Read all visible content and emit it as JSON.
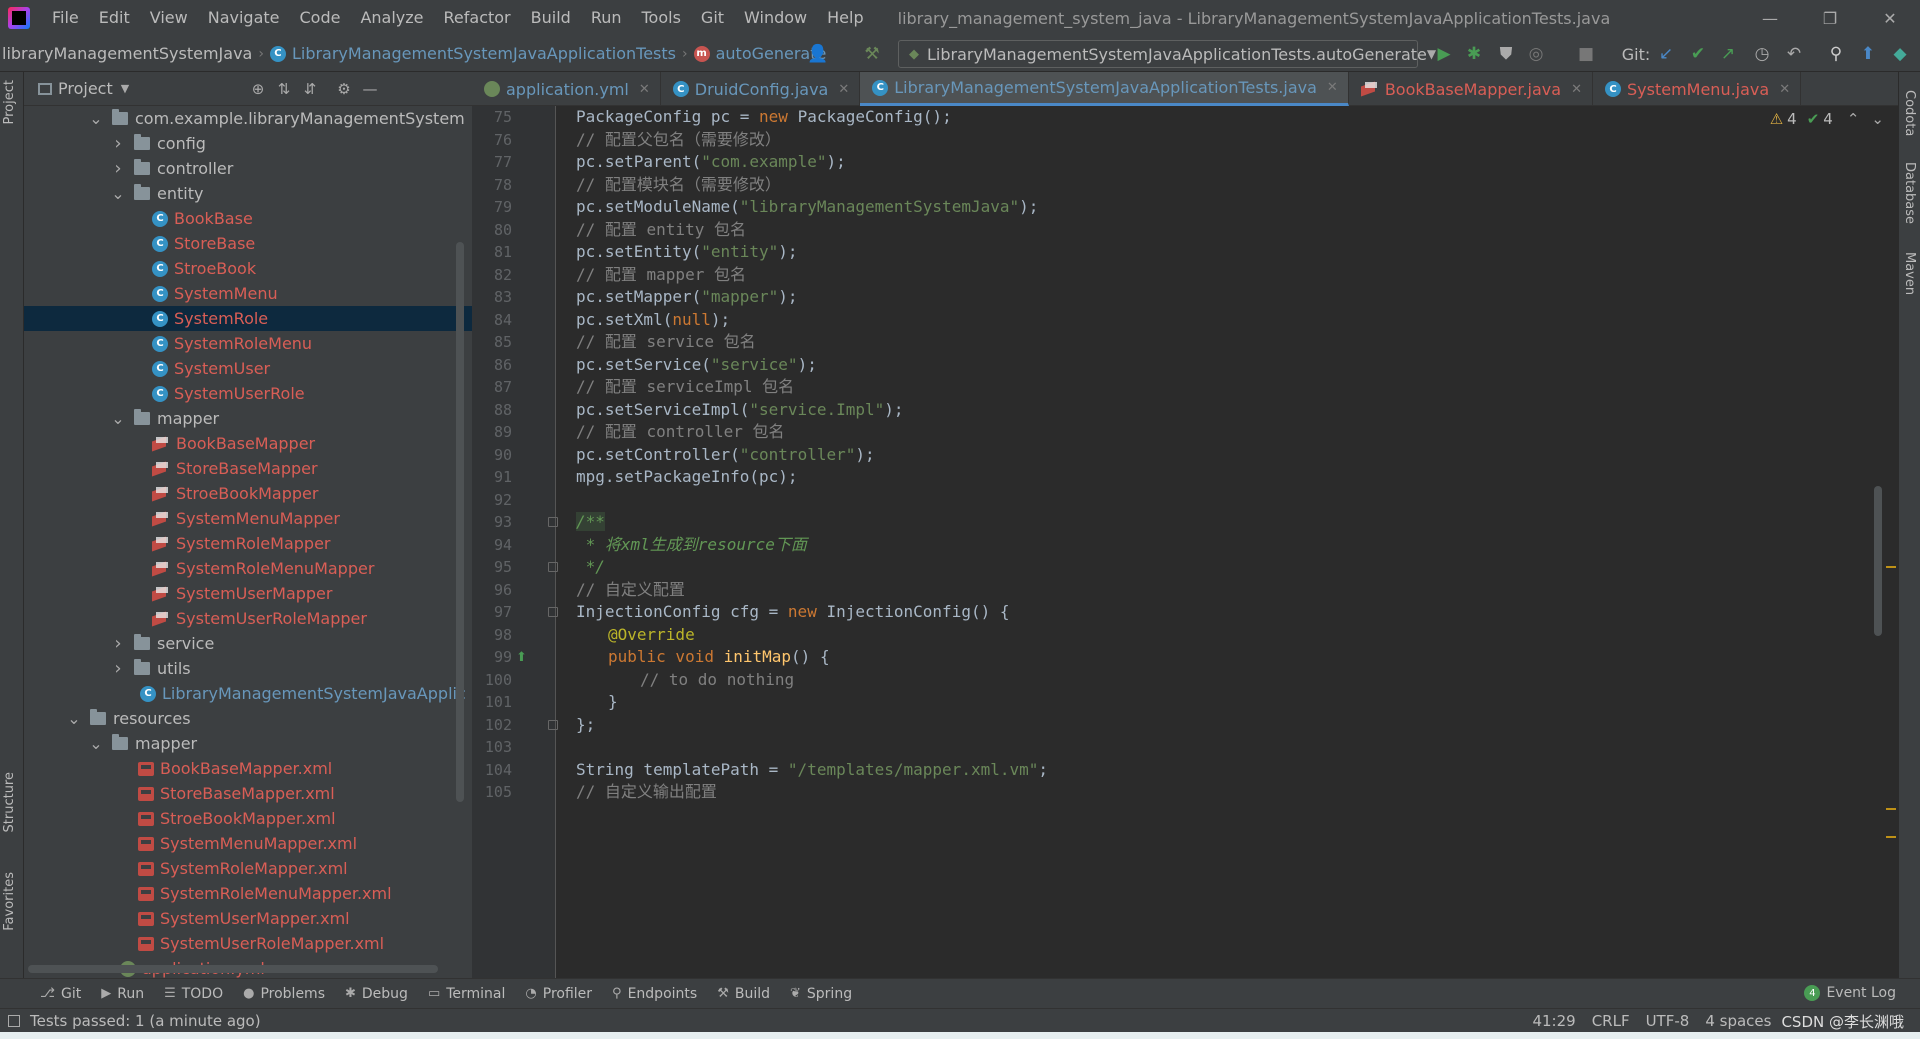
{
  "window": {
    "title": "library_management_system_java - LibraryManagementSystemJavaApplicationTests.java",
    "menu": [
      "File",
      "Edit",
      "View",
      "Navigate",
      "Code",
      "Analyze",
      "Refactor",
      "Build",
      "Run",
      "Tools",
      "Git",
      "Window",
      "Help"
    ]
  },
  "navbar": {
    "crumbs": [
      "libraryManagementSystemJava",
      "LibraryManagementSystemJavaApplicationTests",
      "autoGenerate"
    ],
    "run_config": "LibraryManagementSystemJavaApplicationTests.autoGenerate",
    "git_label": "Git:"
  },
  "project": {
    "title": "Project",
    "tree": [
      {
        "label": "com.example.libraryManagementSystem",
        "type": "package",
        "indent": 1,
        "arrow": "down"
      },
      {
        "label": "config",
        "type": "folder",
        "indent": 2,
        "arrow": "right"
      },
      {
        "label": "controller",
        "type": "folder",
        "indent": 2,
        "arrow": "right"
      },
      {
        "label": "entity",
        "type": "folder",
        "indent": 2,
        "arrow": "down"
      },
      {
        "label": "BookBase",
        "type": "class",
        "indent": 3
      },
      {
        "label": "StoreBase",
        "type": "class",
        "indent": 3
      },
      {
        "label": "StroeBook",
        "type": "class",
        "indent": 3
      },
      {
        "label": "SystemMenu",
        "type": "class",
        "indent": 3
      },
      {
        "label": "SystemRole",
        "type": "class",
        "indent": 3,
        "selected": true
      },
      {
        "label": "SystemRoleMenu",
        "type": "class",
        "indent": 3
      },
      {
        "label": "SystemUser",
        "type": "class",
        "indent": 3
      },
      {
        "label": "SystemUserRole",
        "type": "class",
        "indent": 3
      },
      {
        "label": "mapper",
        "type": "folder",
        "indent": 2,
        "arrow": "down"
      },
      {
        "label": "BookBaseMapper",
        "type": "mapper",
        "indent": 3
      },
      {
        "label": "StoreBaseMapper",
        "type": "mapper",
        "indent": 3
      },
      {
        "label": "StroeBookMapper",
        "type": "mapper",
        "indent": 3
      },
      {
        "label": "SystemMenuMapper",
        "type": "mapper",
        "indent": 3
      },
      {
        "label": "SystemRoleMapper",
        "type": "mapper",
        "indent": 3
      },
      {
        "label": "SystemRoleMenuMapper",
        "type": "mapper",
        "indent": 3
      },
      {
        "label": "SystemUserMapper",
        "type": "mapper",
        "indent": 3
      },
      {
        "label": "SystemUserRoleMapper",
        "type": "mapper",
        "indent": 3
      },
      {
        "label": "service",
        "type": "folder",
        "indent": 2,
        "arrow": "right"
      },
      {
        "label": "utils",
        "type": "folder",
        "indent": 2,
        "arrow": "right"
      },
      {
        "label": "LibraryManagementSystemJavaApplic",
        "type": "appclass",
        "indent": 2
      },
      {
        "label": "resources",
        "type": "resfolder",
        "indent": 0,
        "arrow": "down"
      },
      {
        "label": "mapper",
        "type": "folder",
        "indent": 1,
        "arrow": "down"
      },
      {
        "label": "BookBaseMapper.xml",
        "type": "xml",
        "indent": 2
      },
      {
        "label": "StoreBaseMapper.xml",
        "type": "xml",
        "indent": 2
      },
      {
        "label": "StroeBookMapper.xml",
        "type": "xml",
        "indent": 2
      },
      {
        "label": "SystemMenuMapper.xml",
        "type": "xml",
        "indent": 2
      },
      {
        "label": "SystemRoleMapper.xml",
        "type": "xml",
        "indent": 2
      },
      {
        "label": "SystemRoleMenuMapper.xml",
        "type": "xml",
        "indent": 2
      },
      {
        "label": "SystemUserMapper.xml",
        "type": "xml",
        "indent": 2
      },
      {
        "label": "SystemUserRoleMapper.xml",
        "type": "xml",
        "indent": 2
      },
      {
        "label": "application.yml",
        "type": "yml",
        "indent": 1
      }
    ]
  },
  "tabs": [
    {
      "label": "application.yml",
      "icon": "yml",
      "color": "blue"
    },
    {
      "label": "DruidConfig.java",
      "icon": "class",
      "color": "blue"
    },
    {
      "label": "LibraryManagementSystemJavaApplicationTests.java",
      "icon": "class",
      "color": "blue",
      "active": true
    },
    {
      "label": "BookBaseMapper.java",
      "icon": "mapper",
      "color": "red"
    },
    {
      "label": "SystemMenu.java",
      "icon": "class",
      "color": "red"
    }
  ],
  "editor": {
    "warnings": "4",
    "checks": "4",
    "lines": [
      {
        "n": "75",
        "html": "PackageConfig pc = <span class=\"kw\">new</span> PackageConfig();",
        "indent": 0
      },
      {
        "n": "76",
        "html": "<span class=\"cm\">// 配置父包名（需要修改）</span>",
        "indent": 0
      },
      {
        "n": "77",
        "html": "pc.setParent(<span class=\"str\">\"com.example\"</span>);",
        "indent": 0
      },
      {
        "n": "78",
        "html": "<span class=\"cm\">// 配置模块名（需要修改）</span>",
        "indent": 0
      },
      {
        "n": "79",
        "html": "pc.setModuleName(<span class=\"str\">\"libraryManagementSystemJava\"</span>);",
        "indent": 0
      },
      {
        "n": "80",
        "html": "<span class=\"cm\">// 配置 entity 包名</span>",
        "indent": 0
      },
      {
        "n": "81",
        "html": "pc.setEntity(<span class=\"str\">\"entity\"</span>);",
        "indent": 0
      },
      {
        "n": "82",
        "html": "<span class=\"cm\">// 配置 mapper 包名</span>",
        "indent": 0
      },
      {
        "n": "83",
        "html": "pc.setMapper(<span class=\"str\">\"mapper\"</span>);",
        "indent": 0
      },
      {
        "n": "84",
        "html": "pc.setXml(<span class=\"kw\">null</span>);",
        "indent": 0
      },
      {
        "n": "85",
        "html": "<span class=\"cm\">// 配置 service 包名</span>",
        "indent": 0
      },
      {
        "n": "86",
        "html": "pc.setService(<span class=\"str\">\"service\"</span>);",
        "indent": 0
      },
      {
        "n": "87",
        "html": "<span class=\"cm\">// 配置 serviceImpl 包名</span>",
        "indent": 0
      },
      {
        "n": "88",
        "html": "pc.setServiceImpl(<span class=\"str\">\"service.Impl\"</span>);",
        "indent": 0
      },
      {
        "n": "89",
        "html": "<span class=\"cm\">// 配置 controller 包名</span>",
        "indent": 0
      },
      {
        "n": "90",
        "html": "pc.setController(<span class=\"str\">\"controller\"</span>);",
        "indent": 0
      },
      {
        "n": "91",
        "html": "mpg.setPackageInfo(pc);",
        "indent": 0
      },
      {
        "n": "92",
        "html": "",
        "indent": 0
      },
      {
        "n": "93",
        "html": "<span class=\"doc doc-bg\">/**</span>",
        "indent": 0
      },
      {
        "n": "94",
        "html": "<span class=\"doc\"> * 将xml生成到resource下面</span>",
        "indent": 0
      },
      {
        "n": "95",
        "html": "<span class=\"doc\"> */</span>",
        "indent": 0
      },
      {
        "n": "96",
        "html": "<span class=\"cm\">// 自定义配置</span>",
        "indent": 0
      },
      {
        "n": "97",
        "html": "InjectionConfig cfg = <span class=\"kw\">new</span> InjectionConfig() {",
        "indent": 0
      },
      {
        "n": "98",
        "html": "<span class=\"ann\">@Override</span>",
        "indent": 1
      },
      {
        "n": "99",
        "html": "<span class=\"kw\">public void</span> <span class=\"fn\">initMap</span>() {",
        "indent": 1
      },
      {
        "n": "100",
        "html": "<span class=\"cm\">// to do nothing</span>",
        "indent": 2
      },
      {
        "n": "101",
        "html": "}",
        "indent": 1
      },
      {
        "n": "102",
        "html": "};",
        "indent": 0
      },
      {
        "n": "103",
        "html": "",
        "indent": 0
      },
      {
        "n": "104",
        "html": "String templatePath = <span class=\"str\">\"/templates/mapper.xml.vm\"</span>;",
        "indent": 0
      },
      {
        "n": "105",
        "html": "<span class=\"cm\">// 自定义输出配置</span>",
        "indent": 0
      }
    ]
  },
  "bottom_tabs": [
    {
      "label": "Git",
      "icon": "git-icon",
      "glyph": "⎇"
    },
    {
      "label": "Run",
      "icon": "run-icon",
      "glyph": "▶"
    },
    {
      "label": "TODO",
      "icon": "todo-icon",
      "glyph": "☰"
    },
    {
      "label": "Problems",
      "icon": "problems-icon",
      "glyph": "●"
    },
    {
      "label": "Debug",
      "icon": "debug-icon",
      "glyph": "✱"
    },
    {
      "label": "Terminal",
      "icon": "terminal-icon",
      "glyph": "▭"
    },
    {
      "label": "Profiler",
      "icon": "profiler-icon",
      "glyph": "◔"
    },
    {
      "label": "Endpoints",
      "icon": "endpoints-icon",
      "glyph": "⚲"
    },
    {
      "label": "Build",
      "icon": "build-icon",
      "glyph": "⚒"
    },
    {
      "label": "Spring",
      "icon": "spring-icon",
      "glyph": "❦"
    }
  ],
  "event_log": "Event Log",
  "status": {
    "text": "Tests passed: 1 (a minute ago)",
    "position": "41:29",
    "line_sep": "CRLF",
    "encoding": "UTF-8",
    "indent": "4 spaces",
    "watermark": "CSDN @李长渊哦"
  },
  "side_tabs": {
    "left": [
      "Project",
      "Structure",
      "Favorites"
    ],
    "right": [
      "Codota",
      "Database",
      "Maven"
    ]
  },
  "colors": {
    "accent": "#4a88c7",
    "class_icon": "#3592c4",
    "red_label": "#d95e56",
    "keyword": "#cc7832",
    "string": "#6a8759"
  }
}
